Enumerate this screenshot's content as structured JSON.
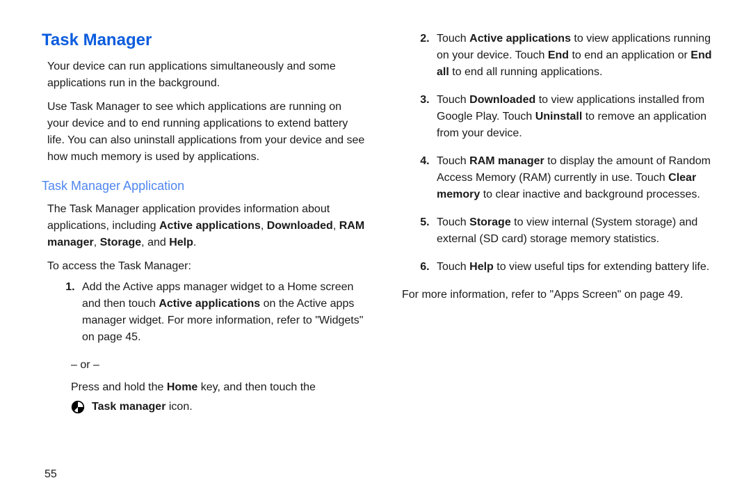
{
  "heading": "Task Manager",
  "intro1": "Your device can run applications simultaneously and some applications run in the background.",
  "intro2": "Use Task Manager to see which applications are running on your device and to end running applications to extend battery life. You can also uninstall applications from your device and see how much memory is used by applications.",
  "subheading": "Task Manager Application",
  "sub_intro_before": "The Task Manager application provides information about applications, including ",
  "b_active_apps": "Active applications",
  "b_downloaded": "Downloaded",
  "b_ram_manager": "RAM manager",
  "b_storage": "Storage",
  "b_help": "Help",
  "sub_intro_after": ".",
  "access_line": "To access the Task Manager:",
  "step1_a": "Add the Active apps manager widget to a Home screen and then touch ",
  "step1_bold": "Active applications",
  "step1_b": " on the Active apps manager widget. For more information, refer to ",
  "step1_ref": "\"Widgets\"",
  "step1_on": " on page 45.",
  "or": "– or –",
  "press_a": "Press and hold the ",
  "press_home": "Home",
  "press_b": " key, and then touch the",
  "tm_icon_label": "Task manager",
  "tm_icon_after": " icon.",
  "step2_a": "Touch ",
  "step2_b1": "Active applications",
  "step2_b": " to view applications running on your device. Touch ",
  "step2_b2": "End",
  "step2_c": " to end an application or ",
  "step2_b3": "End all",
  "step2_d": " to end all running applications.",
  "step3_a": "Touch ",
  "step3_b1": "Downloaded",
  "step3_b": " to view applications installed from Google Play. Touch ",
  "step3_b2": "Uninstall",
  "step3_c": " to remove an application from your device.",
  "step4_a": "Touch ",
  "step4_b1": "RAM manager",
  "step4_b": " to display the amount of Random Access Memory (RAM) currently in use. Touch ",
  "step4_b2": "Clear memory",
  "step4_c": " to clear inactive and background processes.",
  "step5_a": "Touch ",
  "step5_b1": "Storage",
  "step5_b": " to view internal (System storage) and external (SD card) storage memory statistics.",
  "step6_a": "Touch ",
  "step6_b1": "Help",
  "step6_b": " to view useful tips for extending battery life.",
  "moreinfo_a": "For more information, refer to ",
  "moreinfo_ref": "\"Apps Screen\"",
  "moreinfo_on": " on page 49.",
  "page_number": "55",
  "comma": ", ",
  "and": ", and "
}
